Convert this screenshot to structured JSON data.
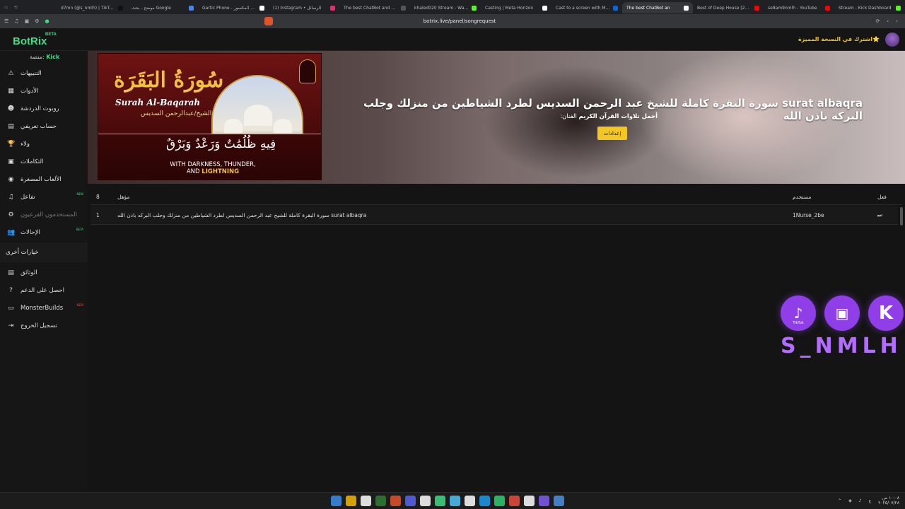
{
  "browser": {
    "tabs": [
      {
        "title": "d7mn (@s_nmlh) | TikTok(5)",
        "color": "#111111"
      },
      {
        "title": "موضح - بحث Google",
        "color": "#4285f4"
      },
      {
        "title": "Gartic Phone - الهاتف المكسور",
        "color": "#ffffff"
      },
      {
        "title": "(1) Instagram • الرسائل",
        "color": "#e1306c"
      },
      {
        "title": "The best ChatBot and Widg",
        "color": "#555555"
      },
      {
        "title": "khaled020 Stream - Watch",
        "color": "#53fc18"
      },
      {
        "title": "Casting | Meta Horizon",
        "color": "#ffffff"
      },
      {
        "title": "Cast to a screen with Meta",
        "color": "#0668e1"
      },
      {
        "title": "The best ChatBot an",
        "color": "#ffffff"
      },
      {
        "title": "Best of Deep House [2025]",
        "color": "#ff0000"
      },
      {
        "title": "se8am9nmlh - YouTube",
        "color": "#ff0000"
      },
      {
        "title": "Stream - Kick Dashboard",
        "color": "#53fc18"
      }
    ],
    "active_tab": 8,
    "url": "botrix.live/panel/songrequest"
  },
  "app": {
    "logo": "BotRix",
    "logo_badge": "BETA",
    "premium_label": "اشترك في النسخة المميزة⭐",
    "platform_label": "منصة:",
    "platform_name": "Kick"
  },
  "sidebar": {
    "items": [
      {
        "label": "التنبيهات",
        "icon": "⚠",
        "name": "alerts"
      },
      {
        "label": "الأدوات",
        "icon": "▦",
        "name": "tools"
      },
      {
        "label": "روبوت الدردشة",
        "icon": "☻",
        "name": "chatbot"
      },
      {
        "label": "حساب تعريفي",
        "icon": "▤",
        "name": "profile"
      },
      {
        "label": "ولاء",
        "icon": "🏆",
        "name": "loyalty"
      },
      {
        "label": "التكاملات",
        "icon": "▣",
        "name": "integrations"
      },
      {
        "label": "الألعاب المصغرة",
        "icon": "◉",
        "name": "minigames"
      },
      {
        "label": "تفاعل",
        "icon": "♫",
        "name": "interaction",
        "badge": "NEW"
      },
      {
        "label": "المستخدمون الفرعيون",
        "icon": "⚙",
        "name": "subusers",
        "dim": true
      },
      {
        "label": "الإحالات",
        "icon": "👥",
        "name": "referrals",
        "badge": "BETA"
      }
    ],
    "other_title": "خيارات أخرى",
    "other_items": [
      {
        "label": "الوثائق",
        "icon": "▤",
        "name": "docs"
      },
      {
        "label": "احصل على الدعم",
        "icon": "?",
        "name": "support"
      },
      {
        "label": "MonsterBuilds",
        "icon": "▭",
        "name": "monsterbuilds",
        "badge": "NEW",
        "badge_red": true
      },
      {
        "label": "تسجيل الخروج",
        "icon": "⇥",
        "name": "logout"
      }
    ]
  },
  "now_playing": {
    "title": "surat albaqra سورة البقرة كاملة للشيخ عبد الرحمن السديس لطرد الشياطين من منزلك وجلب البركه باذن الله",
    "artist_label": "الفنان:",
    "artist": "أجمل تلاوات القرآن الكريم",
    "settings_button": "إعدادات",
    "thumbnail": {
      "ar_title": "سُورَةُ البَقَرَة",
      "en_title": "Surah Al-Baqarah",
      "sheikh": "الشيخ/عبدالرحمن السديس",
      "verse": "فِيهِ ظُلُمَٰتٌ وَرَعْدٌ وَبَرْقٌ",
      "eng_line1": "WITH DARKNESS, THUNDER,",
      "eng_line2_a": "AND ",
      "eng_line2_b": "LIGHTNING"
    }
  },
  "queue": {
    "count": "8",
    "headers": {
      "request": "مؤهل",
      "user": "مستخدم",
      "action": "فعل"
    },
    "rows": [
      {
        "num": "1",
        "title": "surat albaqra سورة البقرة كاملة للشيخ عبد الرحمن السديس لطرد الشياطين من منزلك وجلب البركه باذن الله",
        "user": "1Nurse_2be",
        "action": "⏭"
      }
    ]
  },
  "overlay": {
    "socials": [
      {
        "name": "tiktok",
        "glyph": "♪",
        "sub": "TikTok"
      },
      {
        "name": "twitch",
        "glyph": "▣",
        "sub": ""
      },
      {
        "name": "kick",
        "glyph": "K",
        "sub": ""
      }
    ],
    "handle": "S_NMLH"
  },
  "taskbar": {
    "icon_colors": [
      "#3a8ee6",
      "#f5b800",
      "#ffffff",
      "#2e7d32",
      "#e0542a",
      "#5865f2",
      "#ffffff",
      "#3ddc84",
      "#4fc3f7",
      "#ffffff",
      "#1b9aee",
      "#2ecc71",
      "#e74c3c",
      "#ffffff",
      "#7f5af0",
      "#4a90e2"
    ],
    "time": "١٠:٠٨ ص",
    "date": "٢٠٢٥/٠٧/٢٨",
    "lang": "ع"
  }
}
